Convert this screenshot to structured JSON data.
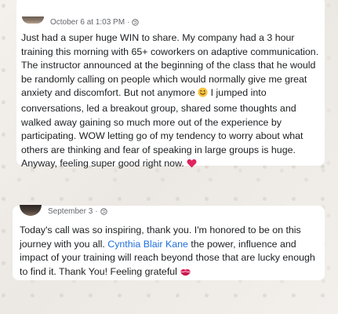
{
  "posts": [
    {
      "timestamp": "October 6 at 1:03 PM",
      "separator": "·",
      "audience_icon": "globe-icon",
      "text_before": "Just had a super huge WIN to share. My company had a 3 hour training this morning with 65+ coworkers on adaptive communication. The instructor announced at the beginning of the class that he would be randomly calling on people which would normally give me great anxiety and discomfort. But not anymore ",
      "emoji_1": "winking-face-emoji",
      "text_middle": " I jumped into conversations, led a breakout group, shared some thoughts and walked away gaining so much more out of the experience by participating. WOW letting go of my tendency to worry about what others are thinking and fear of speaking in large groups is huge. Anyway, feeling super good right now. ",
      "emoji_2": "red-heart-emoji"
    },
    {
      "timestamp": "September 3",
      "separator": "·",
      "audience_icon": "globe-icon",
      "text_before": "Today's call was so inspiring, thank you. I'm honored to be on this journey with you all. ",
      "mention": "Cynthia Blair Kane",
      "text_after": " the power, influence and impact of your training will reach beyond those that are lucky enough to find it. Thank You! Feeling grateful ",
      "emoji": "kiss-mark-emoji"
    }
  ],
  "colors": {
    "background": "#f1eeea",
    "card": "#ffffff",
    "text": "#1c1e21",
    "meta": "#65676b",
    "mention": "#216fdb",
    "heart": "#e0245e"
  }
}
